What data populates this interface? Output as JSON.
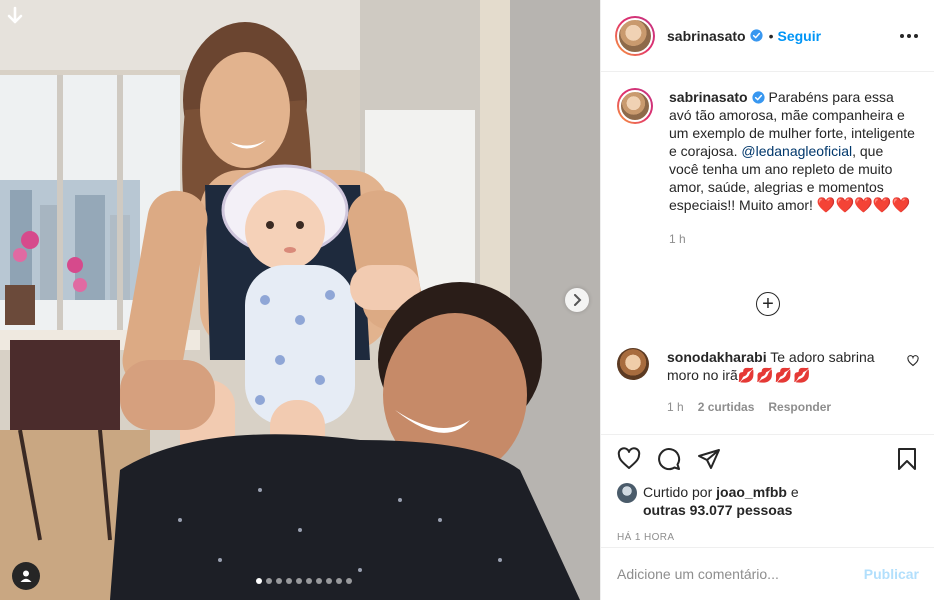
{
  "colors": {
    "accent_blue": "#0095f6",
    "mention": "#00376b",
    "muted": "#8e8e8e",
    "publish_disabled": "#b2dffc",
    "heart_red": "#e0102e"
  },
  "media": {
    "download_icon": "arrow-down-icon",
    "tag_icon": "user-tag-icon",
    "next_icon": "chevron-right-icon",
    "carousel": {
      "count": 10,
      "active_index": 0
    }
  },
  "header": {
    "username": "sabrinasato",
    "separator": "•",
    "follow_label": "Seguir",
    "more_icon": "more-horizontal-icon"
  },
  "caption": {
    "username": "sabrinasato",
    "text_1": " Parabéns para essa avó tão amorosa, mãe companheira e um exemplo de mulher forte, inteligente e corajosa. ",
    "mention": "@ledanagleoficial",
    "text_2": ", que você tenha um ano repleto de muito amor, saúde, alegrias e momentos especiais!! Muito amor! ",
    "hearts": "❤️❤️❤️❤️❤️",
    "time": "1 h"
  },
  "load_more_icon": "plus-circle-icon",
  "comment": {
    "username": "sonodakharabi",
    "text": "Te adoro sabrina moro no irã",
    "kisses": "💋💋💋💋",
    "time": "1 h",
    "likes": "2 curtidas",
    "reply": "Responder"
  },
  "actions": {
    "icons": [
      "heart-icon",
      "comment-icon",
      "share-icon",
      "bookmark-icon"
    ],
    "liked_by_prefix": "Curtido por ",
    "liked_by_user": "joao_mfbb",
    "liked_by_and": " e",
    "others": "outras 93.077 pessoas",
    "posted_ago": "HÁ 1 HORA"
  },
  "add_comment": {
    "placeholder": "Adicione um comentário...",
    "publish_label": "Publicar"
  }
}
